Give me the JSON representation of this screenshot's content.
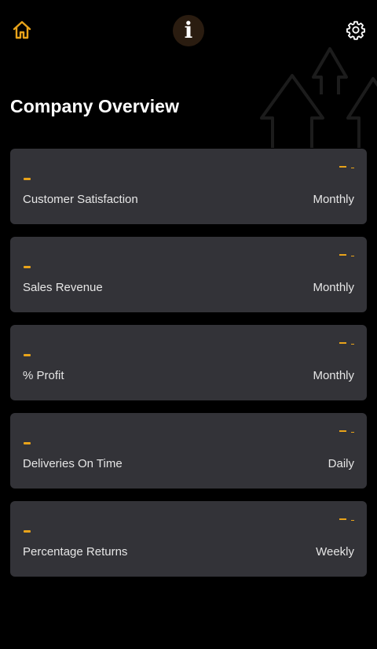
{
  "header": {
    "home_icon": "home-icon",
    "info_icon": "info-icon",
    "info_glyph": "i",
    "settings_icon": "gear-icon"
  },
  "page": {
    "title": "Company Overview"
  },
  "colors": {
    "accent": "#e8a31a",
    "card_bg": "#333338",
    "background": "#000000"
  },
  "metrics": [
    {
      "label": "Customer Satisfaction",
      "period": "Monthly",
      "value": "-",
      "change": "- -"
    },
    {
      "label": "Sales Revenue",
      "period": "Monthly",
      "value": "-",
      "change": "- -"
    },
    {
      "label": "% Profit",
      "period": "Monthly",
      "value": "-",
      "change": "- -"
    },
    {
      "label": "Deliveries On Time",
      "period": "Daily",
      "value": "-",
      "change": "- -"
    },
    {
      "label": "Percentage Returns",
      "period": "Weekly",
      "value": "-",
      "change": "- -"
    }
  ]
}
